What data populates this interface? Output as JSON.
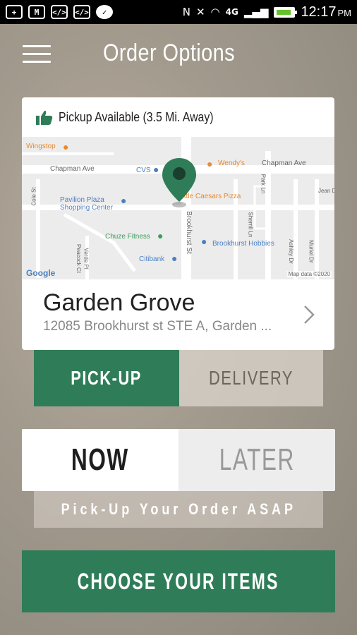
{
  "status_bar": {
    "time": "12:17",
    "ampm": "PM",
    "network": "4G"
  },
  "header": {
    "title": "Order Options"
  },
  "store_card": {
    "pickup_status": "Pickup Available (3.5 Mi. Away)",
    "store_name": "Garden Grove",
    "store_address": "12085 Brookhurst st STE A, Garden ...",
    "map": {
      "streets": [
        "Chapman Ave",
        "Chapman Ave",
        "Brookhurst St",
        "Park Ln",
        "Sherrill Ln",
        "Ashley Dr",
        "Muriel Dr",
        "Jean Dr",
        "Cole St",
        "Peacock Ct",
        "Verde Pl"
      ],
      "places": [
        "Wingstop",
        "CVS",
        "Wendy's",
        "Little Caesars Pizza",
        "Pavilion Plaza Shopping Center",
        "Chuze Fitness",
        "Citibank",
        "Brookhurst Hobbies"
      ],
      "attribution": "Google",
      "map_data": "Map data ©2020"
    }
  },
  "fulfillment_tabs": {
    "pickup_label": "PICK-UP",
    "delivery_label": "DELIVERY",
    "selected": "PICK-UP"
  },
  "time_tabs": {
    "now_label": "NOW",
    "later_label": "LATER",
    "selected": "NOW"
  },
  "asap_message": "Pick-Up Your Order ASAP",
  "cta_label": "CHOOSE YOUR ITEMS",
  "colors": {
    "brand_green": "#2e7d58",
    "map_pin": "#2e7d58"
  }
}
